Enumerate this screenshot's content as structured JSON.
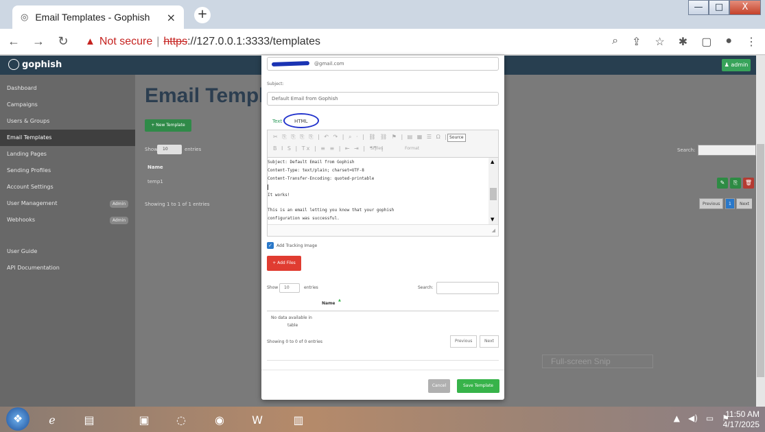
{
  "browser": {
    "tab_title": "Email Templates - Gophish",
    "tab_close": "×",
    "new_tab": "+",
    "url_warning": "Not secure",
    "url_separator": "|",
    "url_scheme": "https",
    "url_rest": "://127.0.0.1:3333/templates",
    "win_min": "—",
    "win_max": "□",
    "win_close": "X"
  },
  "app": {
    "brand": "gophish",
    "admin_label": "admin",
    "sidebar": [
      {
        "label": "Dashboard"
      },
      {
        "label": "Campaigns"
      },
      {
        "label": "Users & Groups"
      },
      {
        "label": "Email Templates",
        "active": true
      },
      {
        "label": "Landing Pages"
      },
      {
        "label": "Sending Profiles"
      },
      {
        "label": "Account Settings"
      },
      {
        "label": "User Management",
        "badge": "Admin"
      },
      {
        "label": "Webhooks",
        "badge": "Admin"
      }
    ],
    "sidebar_bottom": [
      "User Guide",
      "API Documentation"
    ],
    "page_title": "Email Templ",
    "new_template_button": "+ New Template",
    "show_label": "Show",
    "show_value": "10",
    "entries_label": "entries",
    "search_label": "Search:",
    "table_header_name": "Name",
    "table_row_name": "temp1",
    "showing_text": "Showing 1 to 1 of 1 entries",
    "pagination": {
      "previous": "Previous",
      "current": "1",
      "next": "Next"
    }
  },
  "modal": {
    "email_visible": "@gmail.com",
    "subject_label": "Subject:",
    "subject_value": "Default Email from Gophish",
    "tab_text": "Text",
    "tab_html": "HTML",
    "toolbar_row1": "✂ ⎘ ⎘ ⎘ ⎘ | ↶ ↷ | ⌕ · | ⛓ ⛓ ⚑ | ▤ ▦ ☰ Ω | ⛶ |",
    "toolbar_source": "Source",
    "toolbar_row2": "B  I  S | Tx | ≡ ≡ | ⇤ ⇥ | ❝❞ |",
    "toolbar_styles": "Styles",
    "toolbar_format": "Format",
    "editor_lines": [
      "Subject: Default Email from Gophish",
      "Content-Type: text/plain; charset=UTF-8",
      "Content-Transfer-Encoding: quoted-printable",
      "",
      "It works!",
      "",
      "This is an email letting you know that your gophish",
      "configuration was successful."
    ],
    "add_tracking_image": "Add Tracking Image",
    "add_files_button": "+ Add Files",
    "show_label": "Show",
    "show_value": "10",
    "entries_label": "entries",
    "search_label": "Search:",
    "table_header_name": "Name",
    "no_data_line1": "No data available in",
    "no_data_line2": "table",
    "showing_text": "Showing 0 to 0 of 0 entries",
    "previous_button": "Previous",
    "next_button": "Next",
    "cancel_button": "Cancel",
    "save_button": "Save Template"
  },
  "overlay": {
    "snip_label": "Full-screen Snip"
  },
  "taskbar": {
    "time": "11:50 AM",
    "date": "4/17/2025"
  },
  "colors": {
    "navbar": "#283f50",
    "sidebar": "#686868",
    "save_green": "#37b34a",
    "add_files_red": "#e03c31",
    "annotation_blue": "#2233cc"
  }
}
